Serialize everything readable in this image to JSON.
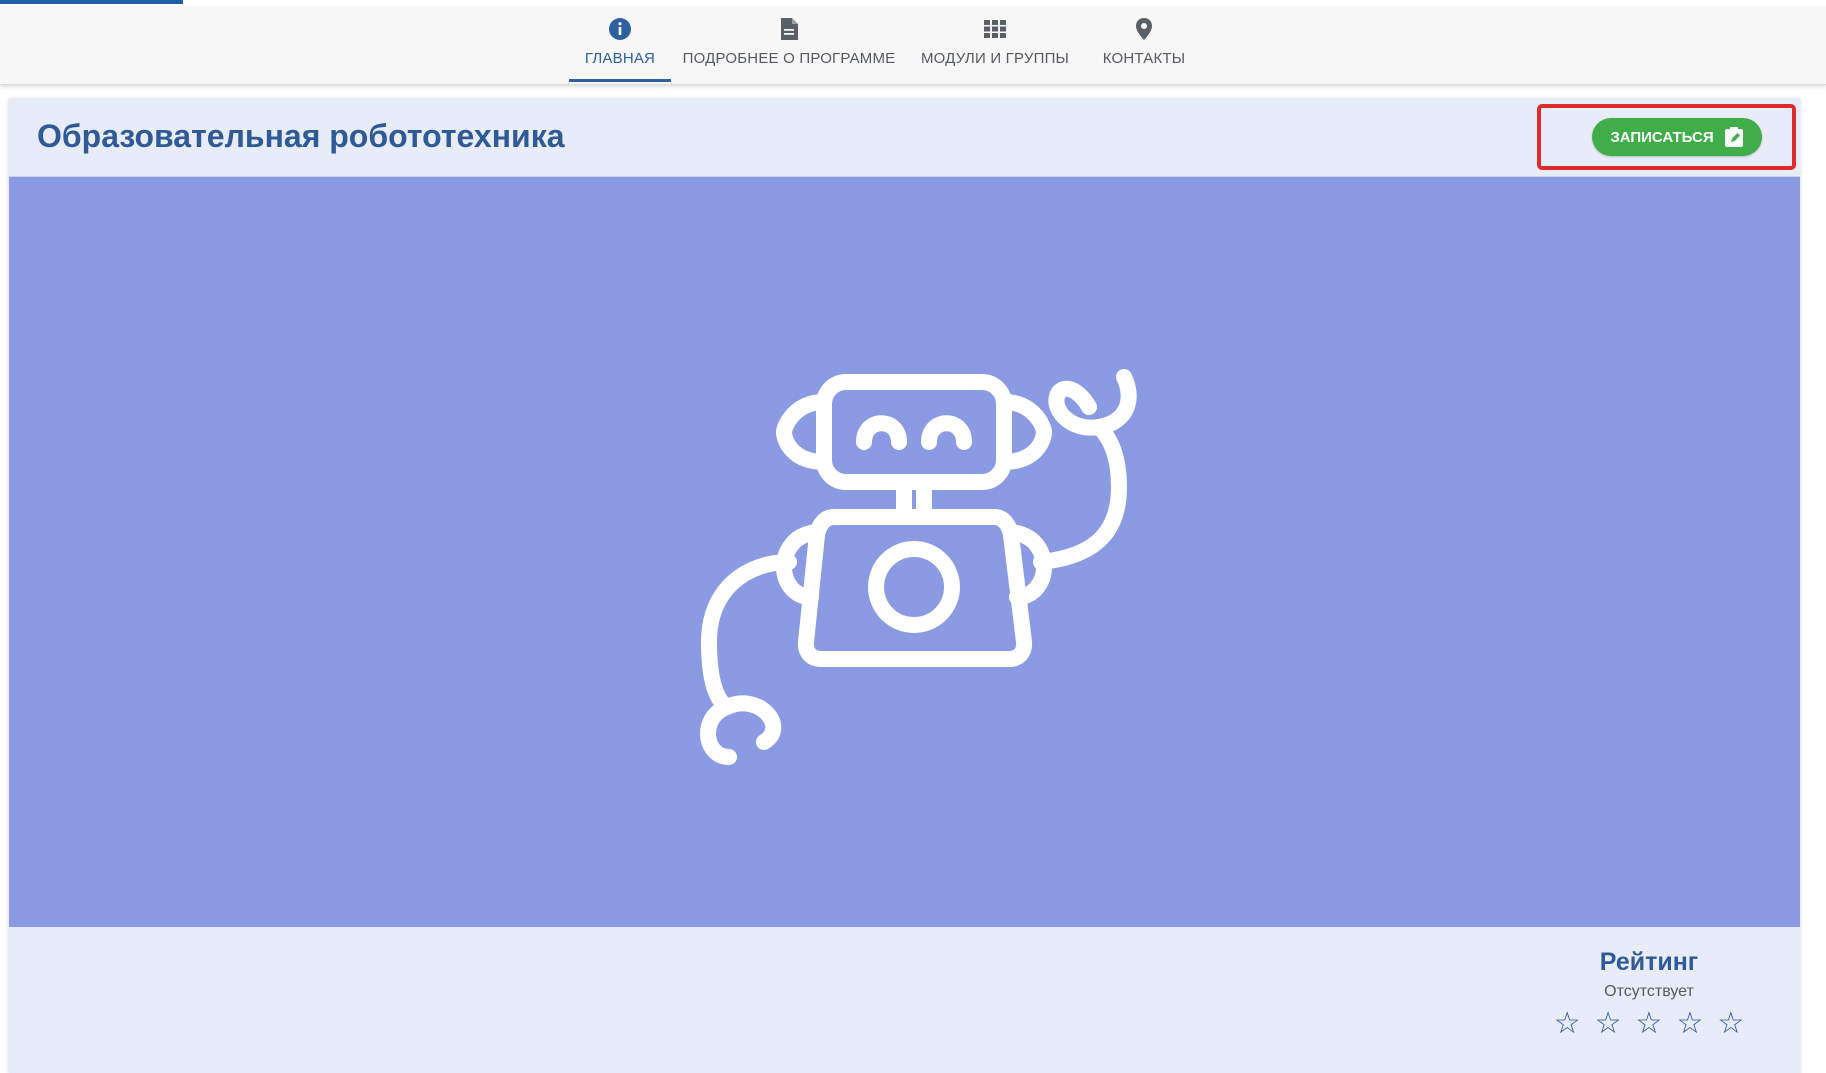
{
  "nav": {
    "tabs": [
      {
        "label": "ГЛАВНАЯ",
        "icon": "info-icon",
        "active": true
      },
      {
        "label": "ПОДРОБНЕЕ О ПРОГРАММЕ",
        "icon": "document-icon",
        "active": false
      },
      {
        "label": "МОДУЛИ И ГРУППЫ",
        "icon": "grid-icon",
        "active": false
      },
      {
        "label": "КОНТАКТЫ",
        "icon": "location-pin-icon",
        "active": false
      }
    ]
  },
  "header": {
    "title": "Образовательная робототехника",
    "signup_label": "ЗАПИСАТЬСЯ",
    "signup_icon": "edit-note-icon"
  },
  "hero": {
    "illustration": "robot-illustration",
    "background": "#8b9be3"
  },
  "rating": {
    "title": "Рейтинг",
    "status": "Отсутствует",
    "stars": [
      "☆",
      "☆",
      "☆",
      "☆",
      "☆"
    ]
  },
  "colors": {
    "accent": "#2f5a98",
    "button": "#3fae48",
    "highlight": "#e02b2b",
    "card_bg": "#e8ebf8"
  }
}
